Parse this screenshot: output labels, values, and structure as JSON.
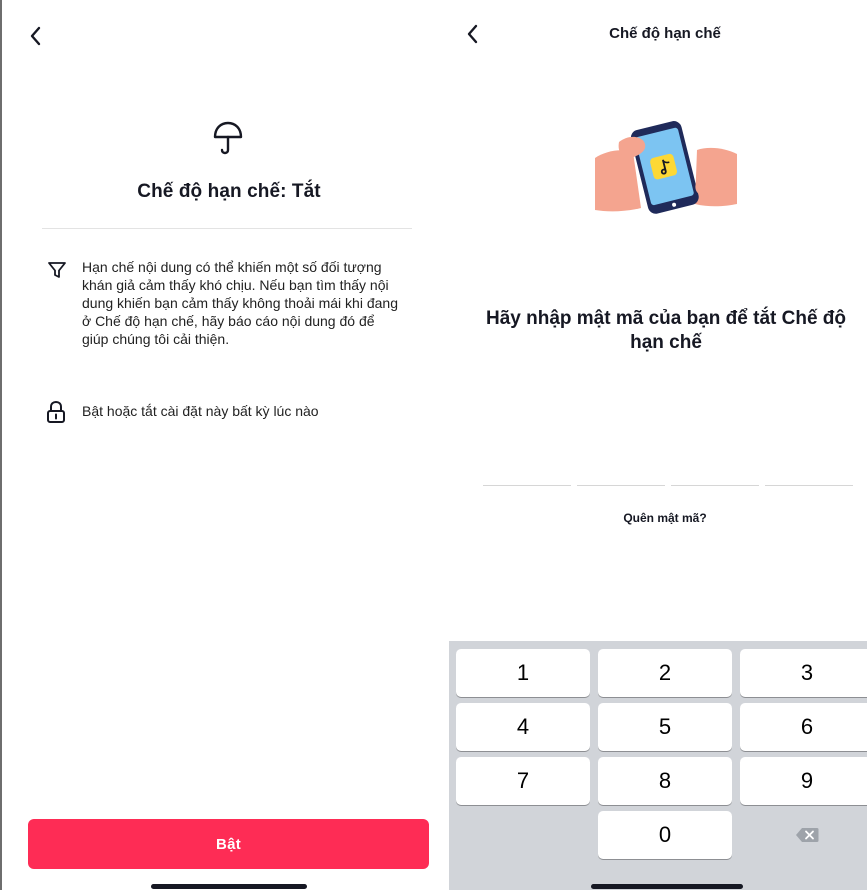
{
  "left_screen": {
    "title": "Chế độ hạn chế: Tắt",
    "info_items": [
      {
        "icon": "filter-icon",
        "text": "Hạn chế nội dung có thể khiến một số đối tượng khán giả cảm thấy khó chịu. Nếu bạn tìm thấy nội dung khiến bạn cảm thấy không thoải mái khi đang ở Chế độ hạn chế, hãy báo cáo nội dung đó để giúp chúng tôi cải thiện."
      },
      {
        "icon": "lock-icon",
        "text": "Bật hoặc tắt cài đặt này bất kỳ lúc nào"
      }
    ],
    "enable_button": "Bật"
  },
  "right_screen": {
    "header_title": "Chế độ hạn chế",
    "heading": "Hãy nhập mật mã của bạn để tắt Chế độ hạn chế",
    "passcode_length": 4,
    "forgot_link": "Quên mật mã?",
    "keypad": {
      "keys": [
        "1",
        "2",
        "3",
        "4",
        "5",
        "6",
        "7",
        "8",
        "9",
        "0"
      ],
      "delete_icon": "backspace-icon"
    }
  },
  "colors": {
    "primary": "#fe2c55",
    "text": "#161823",
    "keypad_bg": "#d1d4d9",
    "divider": "#e3e3e3"
  }
}
